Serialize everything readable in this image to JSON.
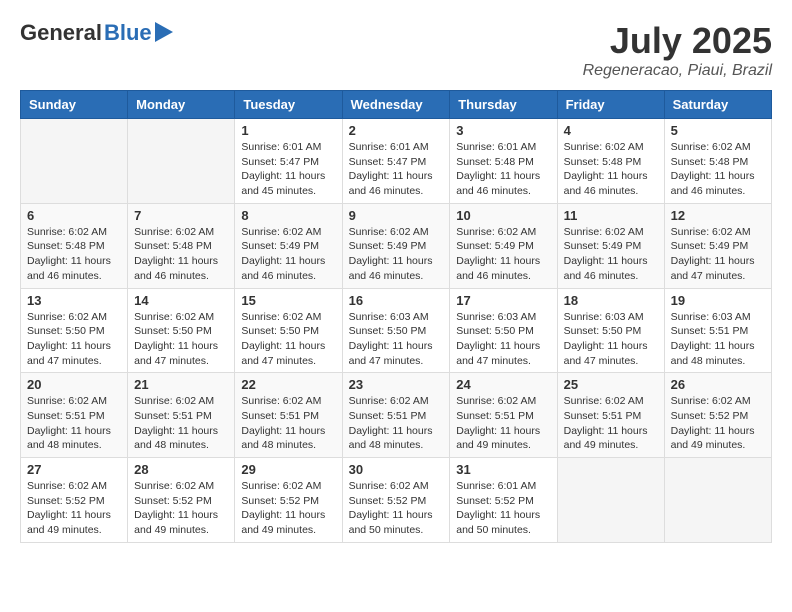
{
  "header": {
    "logo_general": "General",
    "logo_blue": "Blue",
    "month_year": "July 2025",
    "location": "Regeneracao, Piaui, Brazil"
  },
  "days_of_week": [
    "Sunday",
    "Monday",
    "Tuesday",
    "Wednesday",
    "Thursday",
    "Friday",
    "Saturday"
  ],
  "weeks": [
    [
      {
        "day": "",
        "info": ""
      },
      {
        "day": "",
        "info": ""
      },
      {
        "day": "1",
        "info": "Sunrise: 6:01 AM\nSunset: 5:47 PM\nDaylight: 11 hours and 45 minutes."
      },
      {
        "day": "2",
        "info": "Sunrise: 6:01 AM\nSunset: 5:47 PM\nDaylight: 11 hours and 46 minutes."
      },
      {
        "day": "3",
        "info": "Sunrise: 6:01 AM\nSunset: 5:48 PM\nDaylight: 11 hours and 46 minutes."
      },
      {
        "day": "4",
        "info": "Sunrise: 6:02 AM\nSunset: 5:48 PM\nDaylight: 11 hours and 46 minutes."
      },
      {
        "day": "5",
        "info": "Sunrise: 6:02 AM\nSunset: 5:48 PM\nDaylight: 11 hours and 46 minutes."
      }
    ],
    [
      {
        "day": "6",
        "info": "Sunrise: 6:02 AM\nSunset: 5:48 PM\nDaylight: 11 hours and 46 minutes."
      },
      {
        "day": "7",
        "info": "Sunrise: 6:02 AM\nSunset: 5:48 PM\nDaylight: 11 hours and 46 minutes."
      },
      {
        "day": "8",
        "info": "Sunrise: 6:02 AM\nSunset: 5:49 PM\nDaylight: 11 hours and 46 minutes."
      },
      {
        "day": "9",
        "info": "Sunrise: 6:02 AM\nSunset: 5:49 PM\nDaylight: 11 hours and 46 minutes."
      },
      {
        "day": "10",
        "info": "Sunrise: 6:02 AM\nSunset: 5:49 PM\nDaylight: 11 hours and 46 minutes."
      },
      {
        "day": "11",
        "info": "Sunrise: 6:02 AM\nSunset: 5:49 PM\nDaylight: 11 hours and 46 minutes."
      },
      {
        "day": "12",
        "info": "Sunrise: 6:02 AM\nSunset: 5:49 PM\nDaylight: 11 hours and 47 minutes."
      }
    ],
    [
      {
        "day": "13",
        "info": "Sunrise: 6:02 AM\nSunset: 5:50 PM\nDaylight: 11 hours and 47 minutes."
      },
      {
        "day": "14",
        "info": "Sunrise: 6:02 AM\nSunset: 5:50 PM\nDaylight: 11 hours and 47 minutes."
      },
      {
        "day": "15",
        "info": "Sunrise: 6:02 AM\nSunset: 5:50 PM\nDaylight: 11 hours and 47 minutes."
      },
      {
        "day": "16",
        "info": "Sunrise: 6:03 AM\nSunset: 5:50 PM\nDaylight: 11 hours and 47 minutes."
      },
      {
        "day": "17",
        "info": "Sunrise: 6:03 AM\nSunset: 5:50 PM\nDaylight: 11 hours and 47 minutes."
      },
      {
        "day": "18",
        "info": "Sunrise: 6:03 AM\nSunset: 5:50 PM\nDaylight: 11 hours and 47 minutes."
      },
      {
        "day": "19",
        "info": "Sunrise: 6:03 AM\nSunset: 5:51 PM\nDaylight: 11 hours and 48 minutes."
      }
    ],
    [
      {
        "day": "20",
        "info": "Sunrise: 6:02 AM\nSunset: 5:51 PM\nDaylight: 11 hours and 48 minutes."
      },
      {
        "day": "21",
        "info": "Sunrise: 6:02 AM\nSunset: 5:51 PM\nDaylight: 11 hours and 48 minutes."
      },
      {
        "day": "22",
        "info": "Sunrise: 6:02 AM\nSunset: 5:51 PM\nDaylight: 11 hours and 48 minutes."
      },
      {
        "day": "23",
        "info": "Sunrise: 6:02 AM\nSunset: 5:51 PM\nDaylight: 11 hours and 48 minutes."
      },
      {
        "day": "24",
        "info": "Sunrise: 6:02 AM\nSunset: 5:51 PM\nDaylight: 11 hours and 49 minutes."
      },
      {
        "day": "25",
        "info": "Sunrise: 6:02 AM\nSunset: 5:51 PM\nDaylight: 11 hours and 49 minutes."
      },
      {
        "day": "26",
        "info": "Sunrise: 6:02 AM\nSunset: 5:52 PM\nDaylight: 11 hours and 49 minutes."
      }
    ],
    [
      {
        "day": "27",
        "info": "Sunrise: 6:02 AM\nSunset: 5:52 PM\nDaylight: 11 hours and 49 minutes."
      },
      {
        "day": "28",
        "info": "Sunrise: 6:02 AM\nSunset: 5:52 PM\nDaylight: 11 hours and 49 minutes."
      },
      {
        "day": "29",
        "info": "Sunrise: 6:02 AM\nSunset: 5:52 PM\nDaylight: 11 hours and 49 minutes."
      },
      {
        "day": "30",
        "info": "Sunrise: 6:02 AM\nSunset: 5:52 PM\nDaylight: 11 hours and 50 minutes."
      },
      {
        "day": "31",
        "info": "Sunrise: 6:01 AM\nSunset: 5:52 PM\nDaylight: 11 hours and 50 minutes."
      },
      {
        "day": "",
        "info": ""
      },
      {
        "day": "",
        "info": ""
      }
    ]
  ]
}
